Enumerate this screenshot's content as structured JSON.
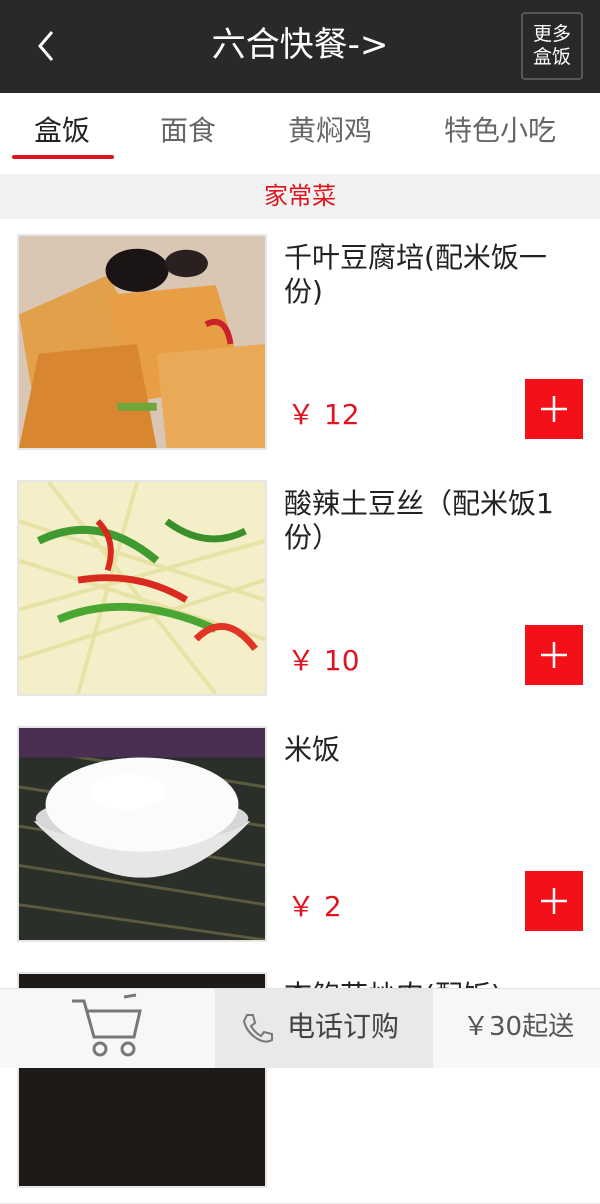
{
  "header": {
    "title": "六合快餐->",
    "more_button": "更多\n盒饭",
    "back_icon": "back-arrow-icon"
  },
  "tabs": [
    {
      "label": "盒饭",
      "active": true
    },
    {
      "label": "面食",
      "active": false
    },
    {
      "label": "黄焖鸡",
      "active": false
    },
    {
      "label": "特色小吃",
      "active": false
    }
  ],
  "category": "家常菜",
  "items": [
    {
      "name": " 千叶豆腐培(配米饭一份)",
      "price": "￥ 12"
    },
    {
      "name": "酸辣土豆丝（配米饭1份）",
      "price": "￥ 10"
    },
    {
      "name": "米饭",
      "price": "￥ 2"
    },
    {
      "name": "杏鲍菇炒肉(配饭)",
      "price": ""
    }
  ],
  "bottom": {
    "phone_label": "电话订购",
    "min_order": "￥30起送",
    "cart_icon": "cart-icon",
    "phone_icon": "phone-icon"
  },
  "colors": {
    "header_bg": "#2b2828",
    "accent": "#e0141e",
    "add_button": "#f41019"
  }
}
